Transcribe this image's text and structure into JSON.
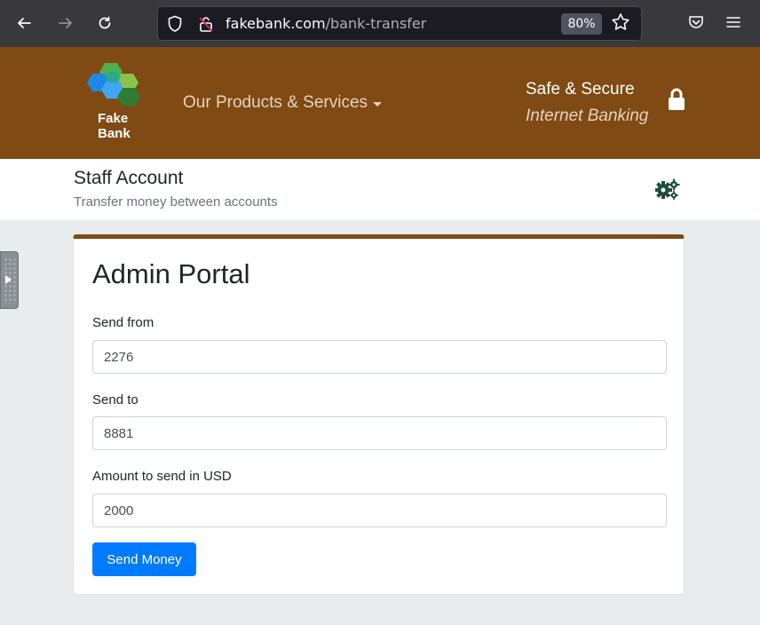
{
  "browser": {
    "url_host": "fakebank.com",
    "url_path": "/bank-transfer",
    "zoom": "80%",
    "back_icon": "arrow-left-icon",
    "forward_icon": "arrow-right-icon",
    "reload_icon": "reload-icon"
  },
  "header": {
    "brand_line1": "Fake",
    "brand_line2": "Bank",
    "products_menu": "Our Products & Services",
    "safe_title": "Safe & Secure",
    "safe_subtitle": "Internet Banking",
    "brand_color": "#7f4a13"
  },
  "account": {
    "title": "Staff Account",
    "subtitle": "Transfer money between accounts"
  },
  "form": {
    "heading": "Admin Portal",
    "send_from_label": "Send from",
    "send_from_value": "2276",
    "send_to_label": "Send to",
    "send_to_value": "8881",
    "amount_label": "Amount to send in USD",
    "amount_value": "2000",
    "submit_label": "Send Money",
    "accent_color": "#007bff"
  }
}
